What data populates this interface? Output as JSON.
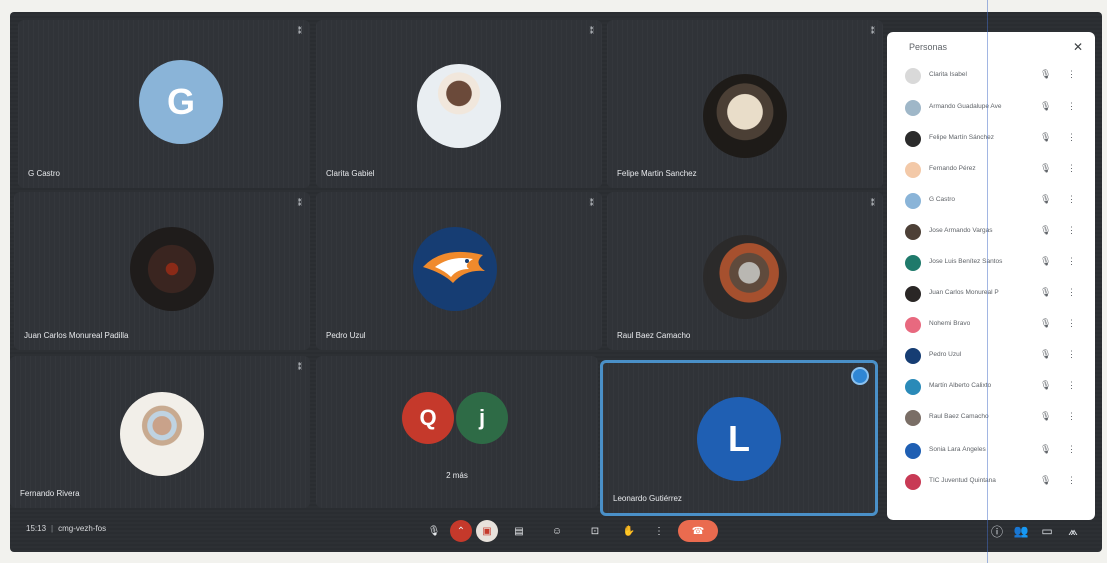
{
  "participants_grid": [
    {
      "name": "G Castro",
      "avatar_letter": "G"
    },
    {
      "name": "Clarita Gabiel",
      "avatar_letter": ""
    },
    {
      "name": "Felipe Martin Sanchez",
      "avatar_letter": ""
    },
    {
      "name": "Juan Carlos Monureal Padilla",
      "avatar_letter": ""
    },
    {
      "name": "Pedro Uzul",
      "avatar_letter": ""
    },
    {
      "name": "Raul Baez Camacho",
      "avatar_letter": ""
    },
    {
      "name": "Fernando Rivera",
      "avatar_letter": ""
    },
    {
      "name": "2 más",
      "avatar_letters": [
        "Q",
        "j"
      ]
    },
    {
      "name": "Leonardo Gutiérrez",
      "avatar_letter": "L"
    }
  ],
  "bottom_bar": {
    "time": "15:13",
    "meeting_code": "cmg-vezh-fos"
  },
  "people_panel": {
    "title": "Personas",
    "close_icon": "close-icon",
    "people": [
      {
        "name": "Clarita Isabel"
      },
      {
        "name": "Armando Guadalupe Ave"
      },
      {
        "name": "Felipe Martín Sánchez"
      },
      {
        "name": "Fernando Pérez"
      },
      {
        "name": "G Castro"
      },
      {
        "name": "Jose Armando Vargas"
      },
      {
        "name": "Jose Luis Benítez Santos"
      },
      {
        "name": "Juan Carlos Monureal P"
      },
      {
        "name": "Nohemi Bravo"
      },
      {
        "name": "Pedro Uzul"
      },
      {
        "name": "Martín Alberto Calixto"
      },
      {
        "name": "Raul Baez Camacho"
      },
      {
        "name": "Sonia Lara Ángeles"
      },
      {
        "name": "TIC Juventud Quintana"
      }
    ]
  },
  "colors": {
    "background": "#2a2d31",
    "tile": "#303338",
    "active_border": "#4a90c8",
    "end_call": "#ea6b4f",
    "panel": "#ffffff"
  }
}
